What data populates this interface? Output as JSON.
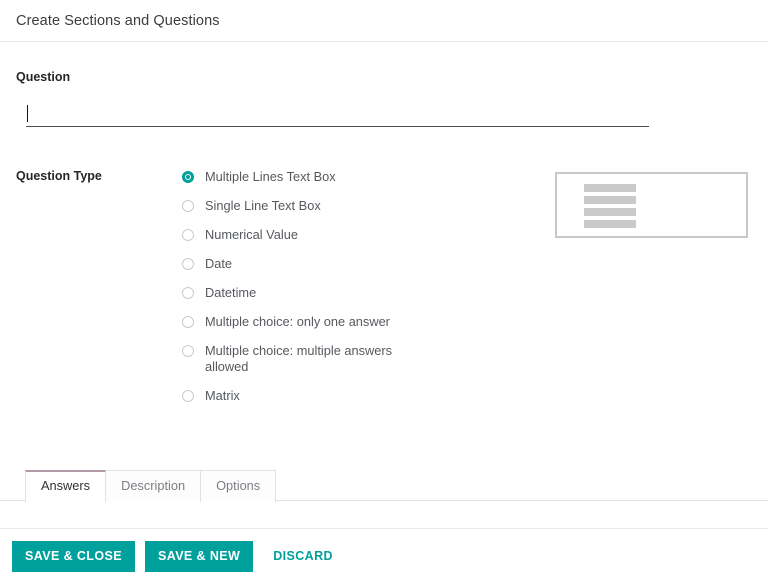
{
  "header": {
    "title": "Create Sections and Questions"
  },
  "form": {
    "question": {
      "label": "Question",
      "value": "",
      "placeholder": ""
    },
    "question_type": {
      "label": "Question Type",
      "selected": "Multiple Lines Text Box",
      "options": [
        {
          "label": "Multiple Lines Text Box",
          "checked": true
        },
        {
          "label": "Single Line Text Box",
          "checked": false
        },
        {
          "label": "Numerical Value",
          "checked": false
        },
        {
          "label": "Date",
          "checked": false
        },
        {
          "label": "Datetime",
          "checked": false
        },
        {
          "label": "Multiple choice: only one answer",
          "checked": false
        },
        {
          "label": "Multiple choice: multiple answers allowed",
          "checked": false
        },
        {
          "label": "Matrix",
          "checked": false
        }
      ]
    },
    "preview": {
      "name": "multiple-lines-preview",
      "line_count": 4
    }
  },
  "tabs": [
    {
      "label": "Answers",
      "active": true
    },
    {
      "label": "Description",
      "active": false
    },
    {
      "label": "Options",
      "active": false
    }
  ],
  "footer": {
    "save_close_label": "SAVE & CLOSE",
    "save_new_label": "SAVE & NEW",
    "discard_label": "DISCARD"
  },
  "colors": {
    "accent_teal": "#00a09d",
    "active_tab_border": "#b59aaa",
    "divider": "#e7e9ed",
    "preview_border": "#c8c8c8",
    "preview_bar": "#c9c9c9"
  }
}
